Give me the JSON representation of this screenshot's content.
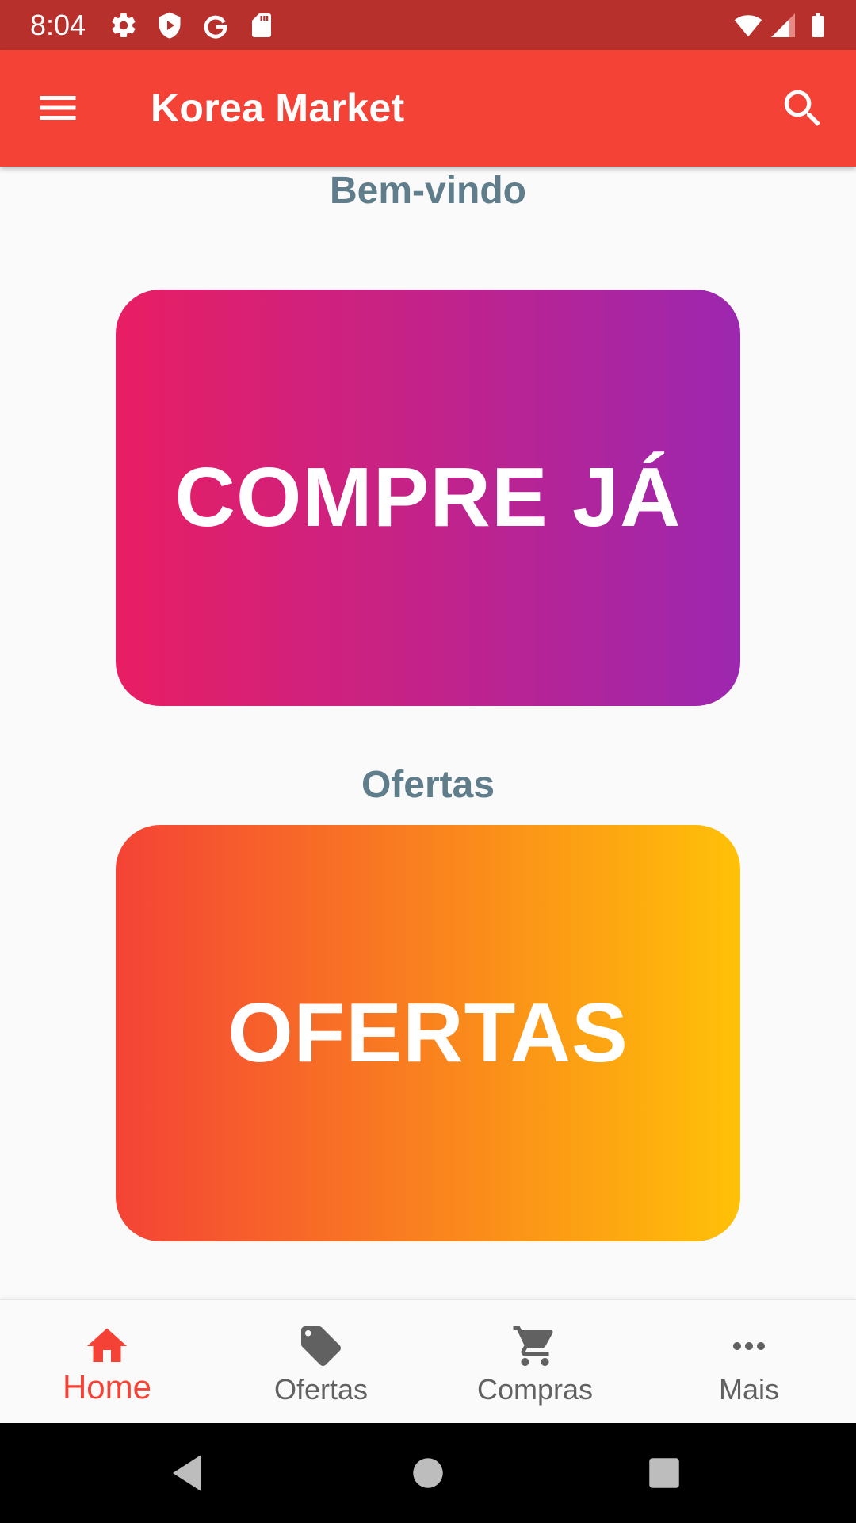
{
  "status_bar": {
    "time": "8:04",
    "left_icons": [
      "gear-icon",
      "shield-play-icon",
      "google-g-icon",
      "sd-card-icon"
    ],
    "right_icons": [
      "wifi-icon",
      "signal-icon",
      "battery-icon"
    ]
  },
  "app_bar": {
    "title": "Korea Market",
    "menu_icon": "hamburger-menu-icon",
    "search_icon": "search-icon",
    "color": "#f44336"
  },
  "main": {
    "welcome_label": "Bem-vindo",
    "buy_card": {
      "text": "COMPRE JÁ",
      "gradient": [
        "#e91e63",
        "#9c27b0"
      ]
    },
    "offers_label": "Ofertas",
    "offers_card": {
      "text": "OFERTAS",
      "gradient": [
        "#f44336",
        "#ffc107"
      ]
    }
  },
  "bottom_nav": {
    "items": [
      {
        "label": "Home",
        "icon": "home-icon",
        "active": true
      },
      {
        "label": "Ofertas",
        "icon": "tag-icon",
        "active": false
      },
      {
        "label": "Compras",
        "icon": "shopping-cart-icon",
        "active": false
      },
      {
        "label": "Mais",
        "icon": "more-horizontal-icon",
        "active": false
      }
    ],
    "active_color": "#f44336",
    "inactive_color": "#616161"
  },
  "system_nav": {
    "buttons": [
      "back-icon",
      "home-circle-icon",
      "recents-icon"
    ]
  }
}
